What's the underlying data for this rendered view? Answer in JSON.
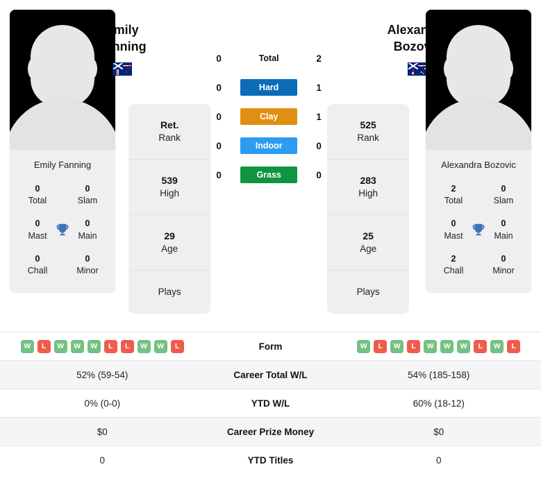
{
  "players": {
    "left": {
      "full_name": "Emily Fanning",
      "name_line1": "Emily",
      "name_line2": "Fanning",
      "card_name": "Emily Fanning",
      "country": "New Zealand",
      "flag": "nz-flag-icon",
      "titles": {
        "total": "0",
        "total_label": "Total",
        "slam": "0",
        "slam_label": "Slam",
        "mast": "0",
        "mast_label": "Mast",
        "main": "0",
        "main_label": "Main",
        "chall": "0",
        "chall_label": "Chall",
        "minor": "0",
        "minor_label": "Minor"
      },
      "stats": [
        {
          "value": "Ret.",
          "label": "Rank"
        },
        {
          "value": "539",
          "label": "High"
        },
        {
          "value": "29",
          "label": "Age"
        },
        {
          "value": "",
          "label": "Plays"
        }
      ],
      "surfaces": {
        "total": "0",
        "hard": "0",
        "clay": "0",
        "indoor": "0",
        "grass": "0"
      },
      "form": [
        "W",
        "L",
        "W",
        "W",
        "W",
        "L",
        "L",
        "W",
        "W",
        "L"
      ],
      "career_total_wl": "52% (59-54)",
      "ytd_wl": "0% (0-0)",
      "career_prize_money": "$0",
      "ytd_titles": "0"
    },
    "right": {
      "full_name": "Alexandra Bozovic",
      "name_line1": "Alexandra",
      "name_line2": "Bozovic",
      "card_name": "Alexandra Bozovic",
      "country": "Australia",
      "flag": "au-flag-icon",
      "titles": {
        "total": "2",
        "total_label": "Total",
        "slam": "0",
        "slam_label": "Slam",
        "mast": "0",
        "mast_label": "Mast",
        "main": "0",
        "main_label": "Main",
        "chall": "2",
        "chall_label": "Chall",
        "minor": "0",
        "minor_label": "Minor"
      },
      "stats": [
        {
          "value": "525",
          "label": "Rank"
        },
        {
          "value": "283",
          "label": "High"
        },
        {
          "value": "25",
          "label": "Age"
        },
        {
          "value": "",
          "label": "Plays"
        }
      ],
      "surfaces": {
        "total": "2",
        "hard": "1",
        "clay": "1",
        "indoor": "0",
        "grass": "0"
      },
      "form": [
        "W",
        "L",
        "W",
        "L",
        "W",
        "W",
        "W",
        "L",
        "W",
        "L"
      ],
      "career_total_wl": "54% (185-158)",
      "ytd_wl": "60% (18-12)",
      "career_prize_money": "$0",
      "ytd_titles": "0"
    }
  },
  "surface_rows": [
    {
      "key": "total",
      "label": "Total",
      "color": "",
      "plain": true
    },
    {
      "key": "hard",
      "label": "Hard",
      "color": "#0b6cb8",
      "plain": false
    },
    {
      "key": "clay",
      "label": "Clay",
      "color": "#e09010",
      "plain": false
    },
    {
      "key": "indoor",
      "label": "Indoor",
      "color": "#2c9cf0",
      "plain": false
    },
    {
      "key": "grass",
      "label": "Grass",
      "color": "#109440",
      "plain": false
    }
  ],
  "table": {
    "rows": [
      {
        "label": "Form",
        "type": "form",
        "alt": false
      },
      {
        "label": "Career Total W/L",
        "key": "career_total_wl",
        "alt": true
      },
      {
        "label": "YTD W/L",
        "key": "ytd_wl",
        "alt": false
      },
      {
        "label": "Career Prize Money",
        "key": "career_prize_money",
        "alt": true
      },
      {
        "label": "YTD Titles",
        "key": "ytd_titles",
        "alt": false
      }
    ]
  },
  "icons": {
    "trophy": "trophy-icon",
    "avatar": "avatar-placeholder-icon"
  },
  "colors": {
    "hard": "#0b6cb8",
    "clay": "#e09010",
    "indoor": "#2c9cf0",
    "grass": "#109440",
    "win": "#73c183",
    "loss": "#ef5b4c",
    "trophy": "#3f72b8",
    "card_bg": "#efefef",
    "row_alt": "#f5f5f5"
  }
}
